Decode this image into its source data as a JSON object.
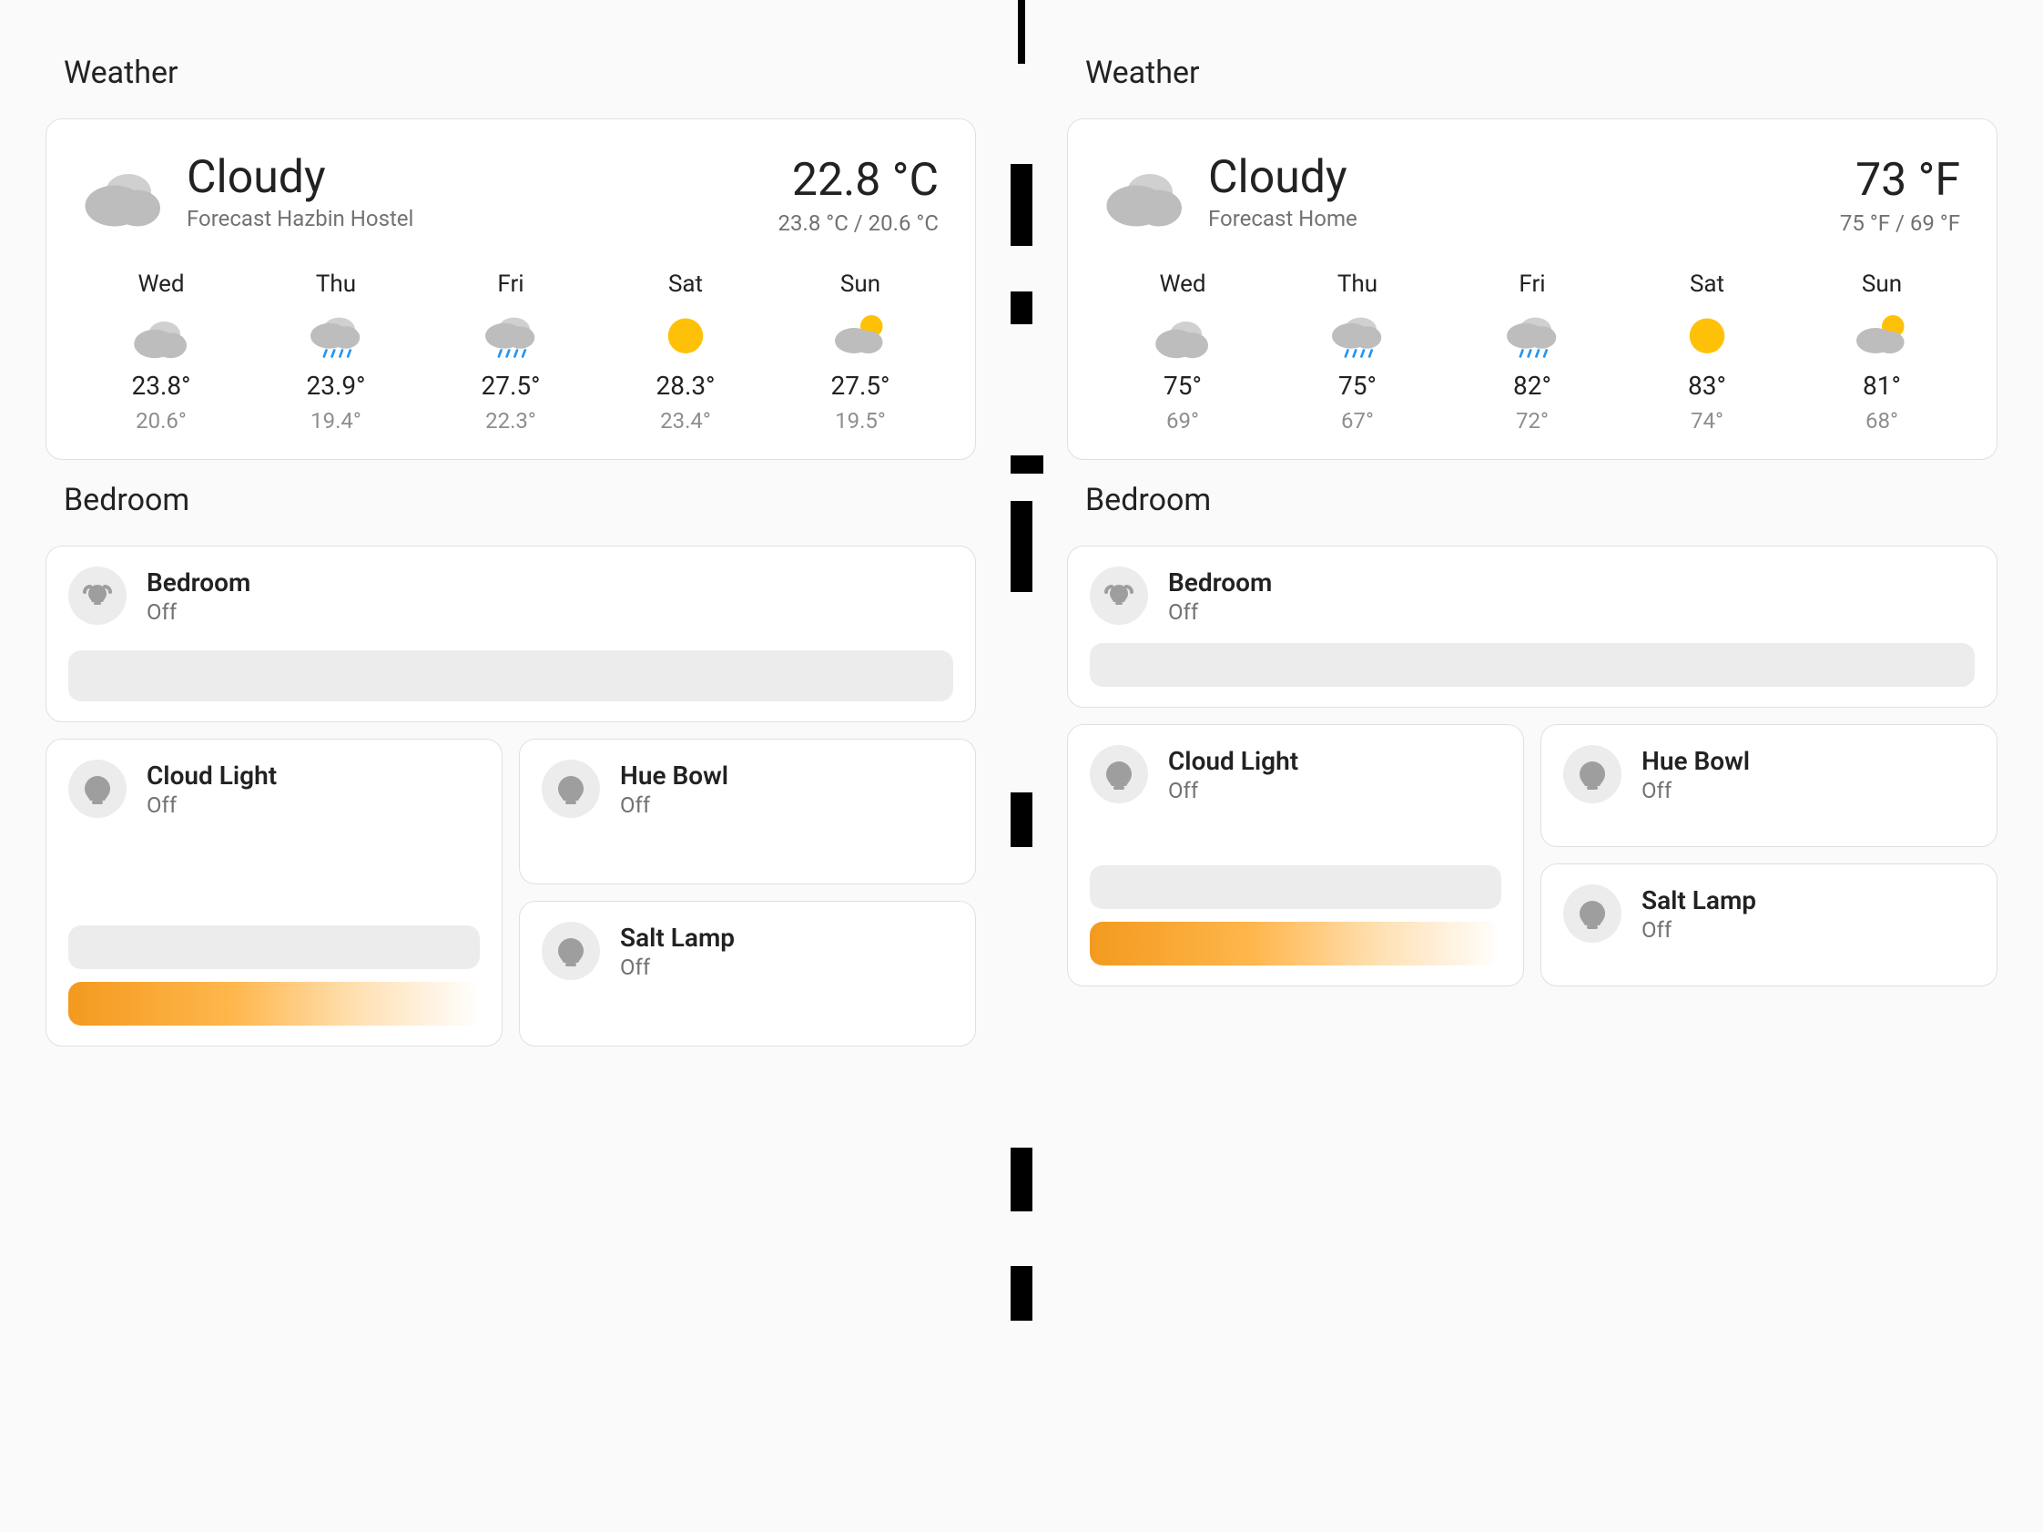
{
  "left": {
    "weather_title": "Weather",
    "condition": "Cloudy",
    "location": "Forecast Hazbin Hostel",
    "temp": "22.8 °C",
    "hilo": "23.8 °C / 20.6 °C",
    "forecast": [
      {
        "day": "Wed",
        "icon": "cloudy",
        "hi": "23.8°",
        "lo": "20.6°"
      },
      {
        "day": "Thu",
        "icon": "rainy",
        "hi": "23.9°",
        "lo": "19.4°"
      },
      {
        "day": "Fri",
        "icon": "rainy",
        "hi": "27.5°",
        "lo": "22.3°"
      },
      {
        "day": "Sat",
        "icon": "sunny",
        "hi": "28.3°",
        "lo": "23.4°"
      },
      {
        "day": "Sun",
        "icon": "partly-cloudy",
        "hi": "27.5°",
        "lo": "19.5°"
      }
    ],
    "bedroom_title": "Bedroom",
    "group": {
      "name": "Bedroom",
      "state": "Off"
    },
    "cloud": {
      "name": "Cloud Light",
      "state": "Off"
    },
    "hue": {
      "name": "Hue Bowl",
      "state": "Off"
    },
    "salt": {
      "name": "Salt Lamp",
      "state": "Off"
    }
  },
  "right": {
    "weather_title": "Weather",
    "condition": "Cloudy",
    "location": "Forecast Home",
    "temp": "73 °F",
    "hilo": "75 °F / 69 °F",
    "forecast": [
      {
        "day": "Wed",
        "icon": "cloudy",
        "hi": "75°",
        "lo": "69°"
      },
      {
        "day": "Thu",
        "icon": "rainy",
        "hi": "75°",
        "lo": "67°"
      },
      {
        "day": "Fri",
        "icon": "rainy",
        "hi": "82°",
        "lo": "72°"
      },
      {
        "day": "Sat",
        "icon": "sunny",
        "hi": "83°",
        "lo": "74°"
      },
      {
        "day": "Sun",
        "icon": "partly-cloudy",
        "hi": "81°",
        "lo": "68°"
      }
    ],
    "bedroom_title": "Bedroom",
    "group": {
      "name": "Bedroom",
      "state": "Off"
    },
    "cloud": {
      "name": "Cloud Light",
      "state": "Off"
    },
    "hue": {
      "name": "Hue Bowl",
      "state": "Off"
    },
    "salt": {
      "name": "Salt Lamp",
      "state": "Off"
    }
  }
}
